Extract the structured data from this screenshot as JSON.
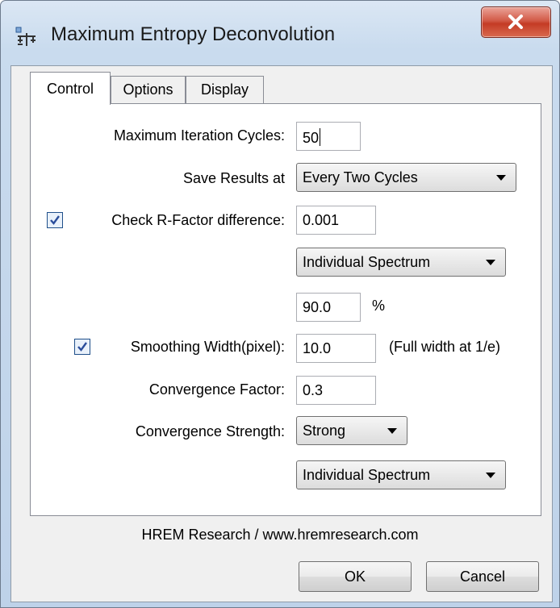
{
  "window": {
    "title": "Maximum Entropy Deconvolution"
  },
  "tabs": [
    "Control",
    "Options",
    "Display"
  ],
  "active_tab": "Control",
  "form": {
    "max_iter_label": "Maximum Iteration Cycles:",
    "max_iter_value": "50",
    "save_results_label": "Save Results at",
    "save_results_value": "Every Two Cycles",
    "rfactor_label": "Check R-Factor difference:",
    "rfactor_checked": true,
    "rfactor_value": "0.001",
    "rfactor_scope": "Individual Spectrum",
    "percent_value": "90.0",
    "percent_unit": "%",
    "smoothing_label": "Smoothing Width(pixel):",
    "smoothing_checked": true,
    "smoothing_value": "10.0",
    "smoothing_note": "(Full width at 1/e)",
    "conv_factor_label": "Convergence Factor:",
    "conv_factor_value": "0.3",
    "conv_strength_label": "Convergence Strength:",
    "conv_strength_value": "Strong",
    "conv_scope": "Individual Spectrum"
  },
  "footer": {
    "credit": "HREM Research / www.hremresearch.com",
    "ok_label": "OK",
    "cancel_label": "Cancel"
  }
}
